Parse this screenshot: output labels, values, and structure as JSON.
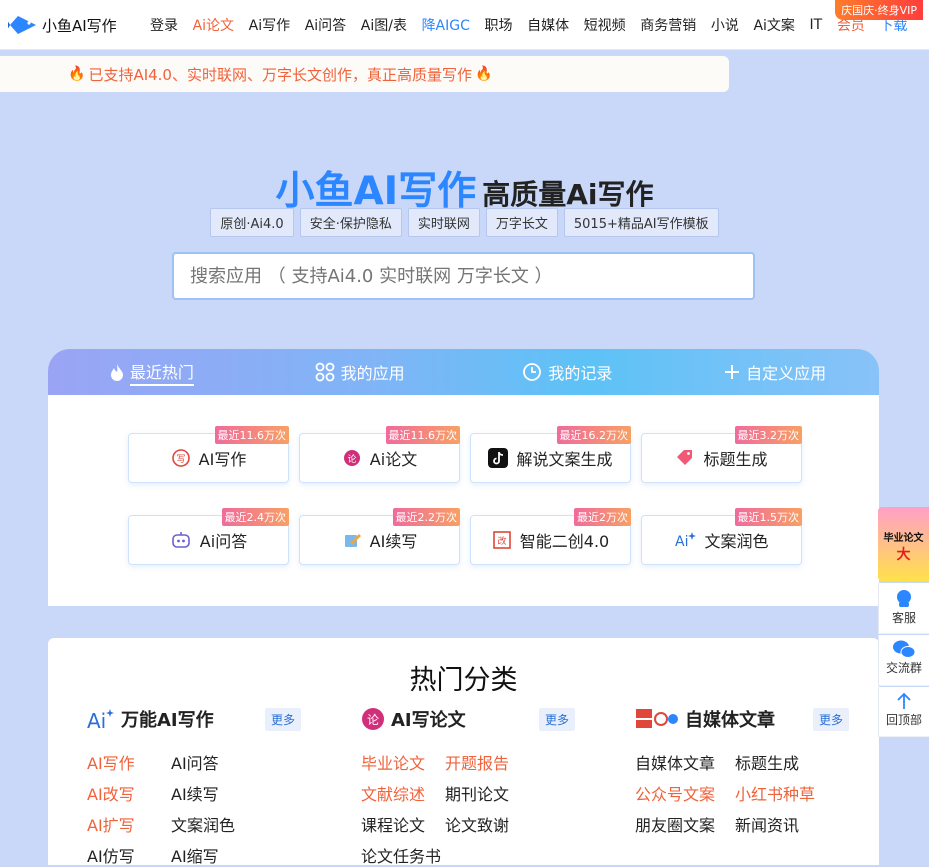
{
  "brand": {
    "name": "小鱼AI写作",
    "accent": "#2b86ff",
    "hot": "#f0623a"
  },
  "nav": {
    "items": [
      {
        "label": "登录"
      },
      {
        "label": "Ai论文"
      },
      {
        "label": "Ai写作"
      },
      {
        "label": "Ai问答"
      },
      {
        "label": "Ai图/表"
      },
      {
        "label": "降AIGC"
      },
      {
        "label": "职场"
      },
      {
        "label": "自媒体"
      },
      {
        "label": "短视频"
      },
      {
        "label": "商务营销"
      },
      {
        "label": "小说"
      },
      {
        "label": "Ai文案"
      },
      {
        "label": "IT"
      },
      {
        "label": "会员"
      },
      {
        "label": "下载"
      }
    ],
    "vip_badge": "庆国庆·终身VIP"
  },
  "announcement": {
    "text": "已支持AI4.0、实时联网、万字长文创作，真正高质量写作"
  },
  "hero": {
    "title": "小鱼AI写作",
    "subtitle": "高质量Ai写作",
    "tags": [
      "原创·Ai4.0",
      "安全·保护隐私",
      "实时联网",
      "万字长文",
      "5015+精品AI写作模板"
    ],
    "search_placeholder": "搜索应用 （ 支持Ai4.0 实时联网 万字长文 ）"
  },
  "tabs": [
    {
      "label": "最近热门",
      "icon": "flame-icon",
      "active": true
    },
    {
      "label": "我的应用",
      "icon": "apps-icon"
    },
    {
      "label": "我的记录",
      "icon": "clock-icon"
    },
    {
      "label": "自定义应用",
      "icon": "plus-icon"
    }
  ],
  "apps": [
    {
      "name": "AI写作",
      "badge": "最近11.6万次"
    },
    {
      "name": "Ai论文",
      "badge": "最近11.6万次"
    },
    {
      "name": "解说文案生成",
      "badge": "最近16.2万次"
    },
    {
      "name": "标题生成",
      "badge": "最近3.2万次"
    },
    {
      "name": "Ai问答",
      "badge": "最近2.4万次"
    },
    {
      "name": "AI续写",
      "badge": "最近2.2万次"
    },
    {
      "name": "智能二创4.0",
      "badge": "最近2万次"
    },
    {
      "name": "文案润色",
      "badge": "最近1.5万次"
    }
  ],
  "categories": {
    "title": "热门分类",
    "more_label": "更多",
    "columns": [
      {
        "name": "万能AI写作",
        "links": [
          [
            "AI写作",
            "AI问答"
          ],
          [
            "AI改写",
            "AI续写"
          ],
          [
            "AI扩写",
            "文案润色"
          ],
          [
            "AI仿写",
            "AI缩写"
          ]
        ]
      },
      {
        "name": "AI写论文",
        "links": [
          [
            "毕业论文",
            "开题报告"
          ],
          [
            "文献综述",
            "期刊论文"
          ],
          [
            "课程论文",
            "论文致谢"
          ],
          [
            "论文任务书",
            ""
          ]
        ]
      },
      {
        "name": "自媒体文章",
        "links": [
          [
            "自媒体文章",
            "标题生成"
          ],
          [
            "公众号文案",
            "小红书种草"
          ],
          [
            "朋友圈文案",
            "新闻资讯"
          ]
        ]
      }
    ]
  },
  "sidebar": {
    "promo_line1": "毕业论文",
    "promo_line2": "大",
    "service": "客服",
    "group": "交流群",
    "top": "回顶部"
  }
}
